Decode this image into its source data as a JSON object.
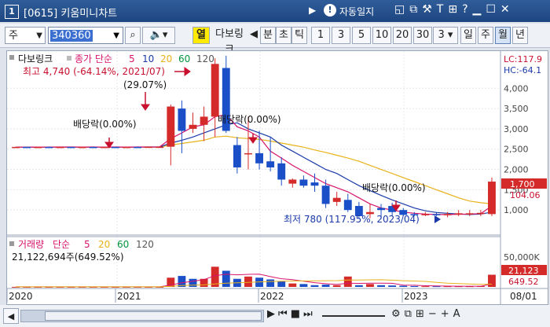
{
  "window": {
    "number": "1",
    "title": "[0615] 키움미니차트",
    "auto_label": "자동일지"
  },
  "toolbar": {
    "market_select": "주",
    "code_value": "340360",
    "col_label": "열",
    "stock_name": "다보링크",
    "period_buttons": [
      "분",
      "초",
      "틱"
    ],
    "interval_buttons": [
      "1",
      "3",
      "5",
      "10",
      "20",
      "30"
    ],
    "n_value": "3",
    "timeframe_buttons": [
      "일",
      "주",
      "월",
      "년"
    ],
    "timeframe_selected": "월"
  },
  "price_panel": {
    "legend_name": "다보링크",
    "legend_ma_label": "종가 단순",
    "legend_ma_periods": [
      "5",
      "10",
      "20",
      "60",
      "120"
    ],
    "ma_colors": [
      "#d8136b",
      "#1a3aa9",
      "#e8b21a",
      "#00953c",
      "#666666"
    ],
    "high_note": "최고 4,740 (-64.14%, 2021/07)",
    "low_note": "최저 780 (117.95%, 2023/04)",
    "pct_note": "(29.07%)",
    "div_note_1": "배당락(0.00%)",
    "div_note_2": "배당락(0.00%)",
    "div_note_3": "배당락(0.00%)",
    "lc_label": "LC:117.9",
    "hc_label": "HC:-64.1",
    "y_ticks": [
      "4,000",
      "3,500",
      "3,000",
      "2,500",
      "2,000",
      "1,500",
      "1,000"
    ],
    "current_price": "1,700",
    "current_change": "104.06"
  },
  "volume_panel": {
    "label": "거래량",
    "ma_label": "단순",
    "ma_periods": [
      "5",
      "20",
      "60",
      "120"
    ],
    "value_text": "21,122,694주(649.52%)",
    "y_tick": "50,000K",
    "current_volume": "21,123",
    "current_pct": "649.52"
  },
  "x_axis": {
    "labels": [
      "2020",
      "2021",
      "2022",
      "2023",
      "08/01"
    ]
  },
  "chart_data": {
    "type": "candlestick",
    "timeframe": "monthly",
    "ylim": [
      500,
      4800
    ],
    "candles": [
      {
        "o": 2550,
        "h": 2560,
        "l": 2540,
        "c": 2555
      },
      {
        "o": 2555,
        "h": 2560,
        "l": 2545,
        "c": 2550
      },
      {
        "o": 2550,
        "h": 2560,
        "l": 2545,
        "c": 2555
      },
      {
        "o": 2555,
        "h": 2565,
        "l": 2545,
        "c": 2550
      },
      {
        "o": 2550,
        "h": 2560,
        "l": 2540,
        "c": 2555
      },
      {
        "o": 2555,
        "h": 2560,
        "l": 2545,
        "c": 2550
      },
      {
        "o": 2550,
        "h": 2560,
        "l": 2545,
        "c": 2555
      },
      {
        "o": 2555,
        "h": 2560,
        "l": 2545,
        "c": 2550
      },
      {
        "o": 2550,
        "h": 2560,
        "l": 2545,
        "c": 2555
      },
      {
        "o": 2555,
        "h": 2560,
        "l": 2545,
        "c": 2550
      },
      {
        "o": 2550,
        "h": 2560,
        "l": 2540,
        "c": 2555
      },
      {
        "o": 2555,
        "h": 2565,
        "l": 2545,
        "c": 2550
      },
      {
        "o": 2550,
        "h": 2560,
        "l": 2545,
        "c": 2560
      },
      {
        "o": 2560,
        "h": 2570,
        "l": 2550,
        "c": 2560
      },
      {
        "o": 2560,
        "h": 3600,
        "l": 2100,
        "c": 3550
      },
      {
        "o": 3500,
        "h": 3700,
        "l": 2400,
        "c": 2950
      },
      {
        "o": 3000,
        "h": 3400,
        "l": 2900,
        "c": 3100
      },
      {
        "o": 3100,
        "h": 3550,
        "l": 2700,
        "c": 3300
      },
      {
        "o": 3300,
        "h": 4740,
        "l": 2800,
        "c": 4600
      },
      {
        "o": 4500,
        "h": 4800,
        "l": 2900,
        "c": 2950
      },
      {
        "o": 2600,
        "h": 2800,
        "l": 1900,
        "c": 2050
      },
      {
        "o": 2400,
        "h": 3300,
        "l": 2000,
        "c": 2400
      },
      {
        "o": 2400,
        "h": 2950,
        "l": 2000,
        "c": 2150
      },
      {
        "o": 2200,
        "h": 2800,
        "l": 1950,
        "c": 2050
      },
      {
        "o": 2150,
        "h": 2300,
        "l": 1600,
        "c": 1750
      },
      {
        "o": 1650,
        "h": 1780,
        "l": 1550,
        "c": 1750
      },
      {
        "o": 1750,
        "h": 1850,
        "l": 1550,
        "c": 1600
      },
      {
        "o": 1680,
        "h": 1900,
        "l": 1450,
        "c": 1600
      },
      {
        "o": 1600,
        "h": 1750,
        "l": 1050,
        "c": 1150
      },
      {
        "o": 1200,
        "h": 1450,
        "l": 1100,
        "c": 1300
      },
      {
        "o": 1250,
        "h": 1400,
        "l": 950,
        "c": 1000
      },
      {
        "o": 1100,
        "h": 1200,
        "l": 780,
        "c": 850
      },
      {
        "o": 900,
        "h": 1150,
        "l": 800,
        "c": 950
      },
      {
        "o": 1050,
        "h": 1150,
        "l": 780,
        "c": 1000
      },
      {
        "o": 1100,
        "h": 1180,
        "l": 850,
        "c": 950
      },
      {
        "o": 1000,
        "h": 1050,
        "l": 850,
        "c": 880
      },
      {
        "o": 900,
        "h": 950,
        "l": 850,
        "c": 880
      },
      {
        "o": 880,
        "h": 950,
        "l": 850,
        "c": 900
      },
      {
        "o": 900,
        "h": 950,
        "l": 850,
        "c": 880
      },
      {
        "o": 880,
        "h": 950,
        "l": 820,
        "c": 900
      },
      {
        "o": 900,
        "h": 1000,
        "l": 850,
        "c": 920
      },
      {
        "o": 900,
        "h": 1000,
        "l": 850,
        "c": 920
      },
      {
        "o": 900,
        "h": 1000,
        "l": 850,
        "c": 930
      },
      {
        "o": 900,
        "h": 1800,
        "l": 850,
        "c": 1700
      }
    ],
    "volume_ylim": [
      0,
      60000
    ],
    "volume": [
      80,
      80,
      80,
      80,
      80,
      80,
      80,
      80,
      80,
      80,
      80,
      80,
      100,
      120,
      16000,
      19000,
      14000,
      14000,
      35000,
      28000,
      14000,
      18000,
      16000,
      13000,
      10000,
      6000,
      5000,
      3000,
      4000,
      3000,
      18000,
      3000,
      5000,
      3000,
      2500,
      2000,
      1500,
      1200,
      1200,
      1200,
      1200,
      1200,
      1500,
      21123
    ],
    "volume_up": [
      true,
      true,
      true,
      true,
      true,
      true,
      true,
      true,
      true,
      true,
      true,
      true,
      true,
      true,
      true,
      false,
      false,
      true,
      true,
      false,
      false,
      true,
      false,
      false,
      false,
      true,
      false,
      false,
      false,
      true,
      true,
      false,
      true,
      false,
      false,
      false,
      false,
      true,
      false,
      true,
      true,
      true,
      true,
      true
    ],
    "ma5": [
      2550,
      2550,
      2552,
      2552,
      2553,
      2553,
      2552,
      2553,
      2552,
      2553,
      2552,
      2553,
      2554,
      2556,
      2760,
      2900,
      3050,
      3100,
      3300,
      3350,
      3050,
      2950,
      2800,
      2450,
      2280,
      2100,
      1950,
      1800,
      1650,
      1550,
      1450,
      1300,
      1150,
      1050,
      1000,
      950,
      920,
      900,
      890,
      890,
      895,
      900,
      910,
      1100
    ],
    "ma10": [
      2550,
      2550,
      2550,
      2551,
      2551,
      2552,
      2552,
      2552,
      2552,
      2552,
      2552,
      2552,
      2553,
      2554,
      2650,
      2720,
      2800,
      2900,
      3000,
      3100,
      3150,
      3000,
      2900,
      2800,
      2600,
      2450,
      2300,
      2150,
      2000,
      1900,
      1750,
      1600,
      1480,
      1360,
      1250,
      1150,
      1050,
      980,
      940,
      920,
      900,
      890,
      900,
      950
    ],
    "ma20": [
      2550,
      2550,
      2550,
      2550,
      2550,
      2550,
      2550,
      2550,
      2550,
      2550,
      2550,
      2550,
      2551,
      2552,
      2600,
      2640,
      2680,
      2720,
      2800,
      2820,
      2780,
      2760,
      2740,
      2700,
      2650,
      2600,
      2550,
      2480,
      2420,
      2350,
      2280,
      2200,
      2100,
      2000,
      1900,
      1800,
      1700,
      1600,
      1500,
      1400,
      1300,
      1220,
      1180,
      1150
    ]
  }
}
